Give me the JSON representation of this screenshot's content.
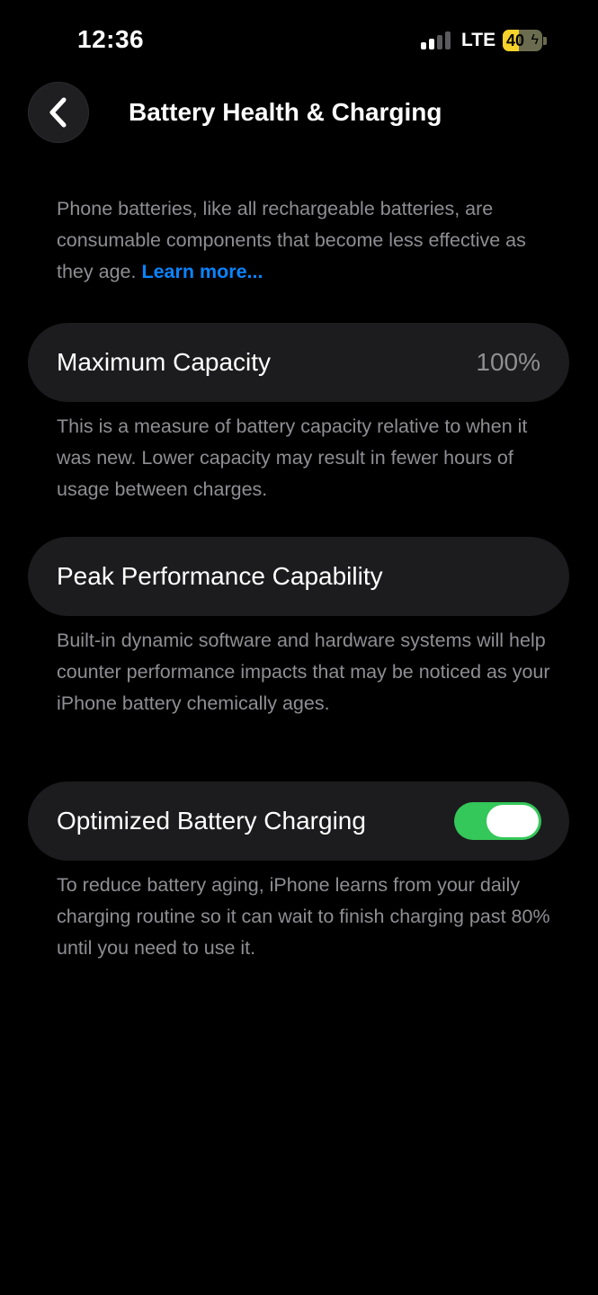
{
  "status_bar": {
    "time": "12:36",
    "network": "LTE",
    "battery_level": "40",
    "battery_fraction": 0.4,
    "battery_color": "#f6d32b",
    "signal_bars_active": 2,
    "signal_bars_total": 4
  },
  "nav": {
    "back_icon": "chevron-left-icon",
    "title": "Battery Health & Charging"
  },
  "intro": {
    "text": "Phone batteries, like all rechargeable batteries, are consumable components that become less effective as they age.",
    "link_label": "Learn more..."
  },
  "max_capacity": {
    "label": "Maximum Capacity",
    "value": "100%",
    "description": "This is a measure of battery capacity relative to when it was new. Lower capacity may result in fewer hours of usage between charges."
  },
  "peak_performance": {
    "label": "Peak Performance Capability",
    "description": "Built-in dynamic software and hardware systems will help counter performance impacts that may be noticed as your iPhone battery chemically ages."
  },
  "optimized_charging": {
    "label": "Optimized Battery Charging",
    "enabled": true,
    "toggle_color": "#34c759",
    "description": "To reduce battery aging, iPhone learns from your daily charging routine so it can wait to finish charging past 80% until you need to use it."
  },
  "colors": {
    "background": "#000000",
    "card": "#1c1c1e",
    "secondary_text": "#8e8e93",
    "link": "#0a84ff"
  }
}
